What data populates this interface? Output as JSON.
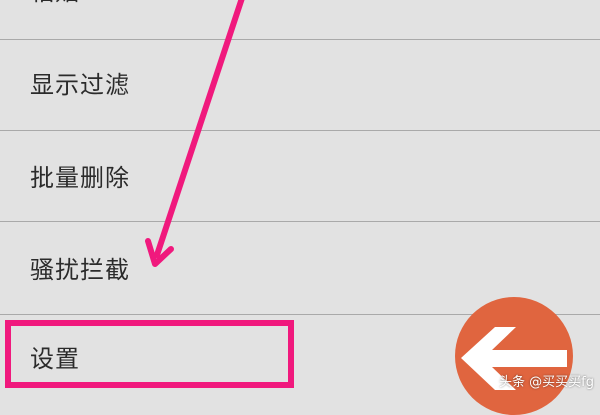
{
  "menu": {
    "items": [
      {
        "label": "粘贴"
      },
      {
        "label": "显示过滤"
      },
      {
        "label": "批量删除"
      },
      {
        "label": "骚扰拦截"
      },
      {
        "label": "设置"
      }
    ]
  },
  "colors": {
    "background": "#e2e2e2",
    "divider": "#a9a9a9",
    "highlight": "#f0197d",
    "annotation_arrow": "#f0197d",
    "back_button": "#e0653f"
  },
  "icons": {
    "back": "back-arrow-icon"
  },
  "watermark": {
    "text": "头条 @买买买fg"
  }
}
